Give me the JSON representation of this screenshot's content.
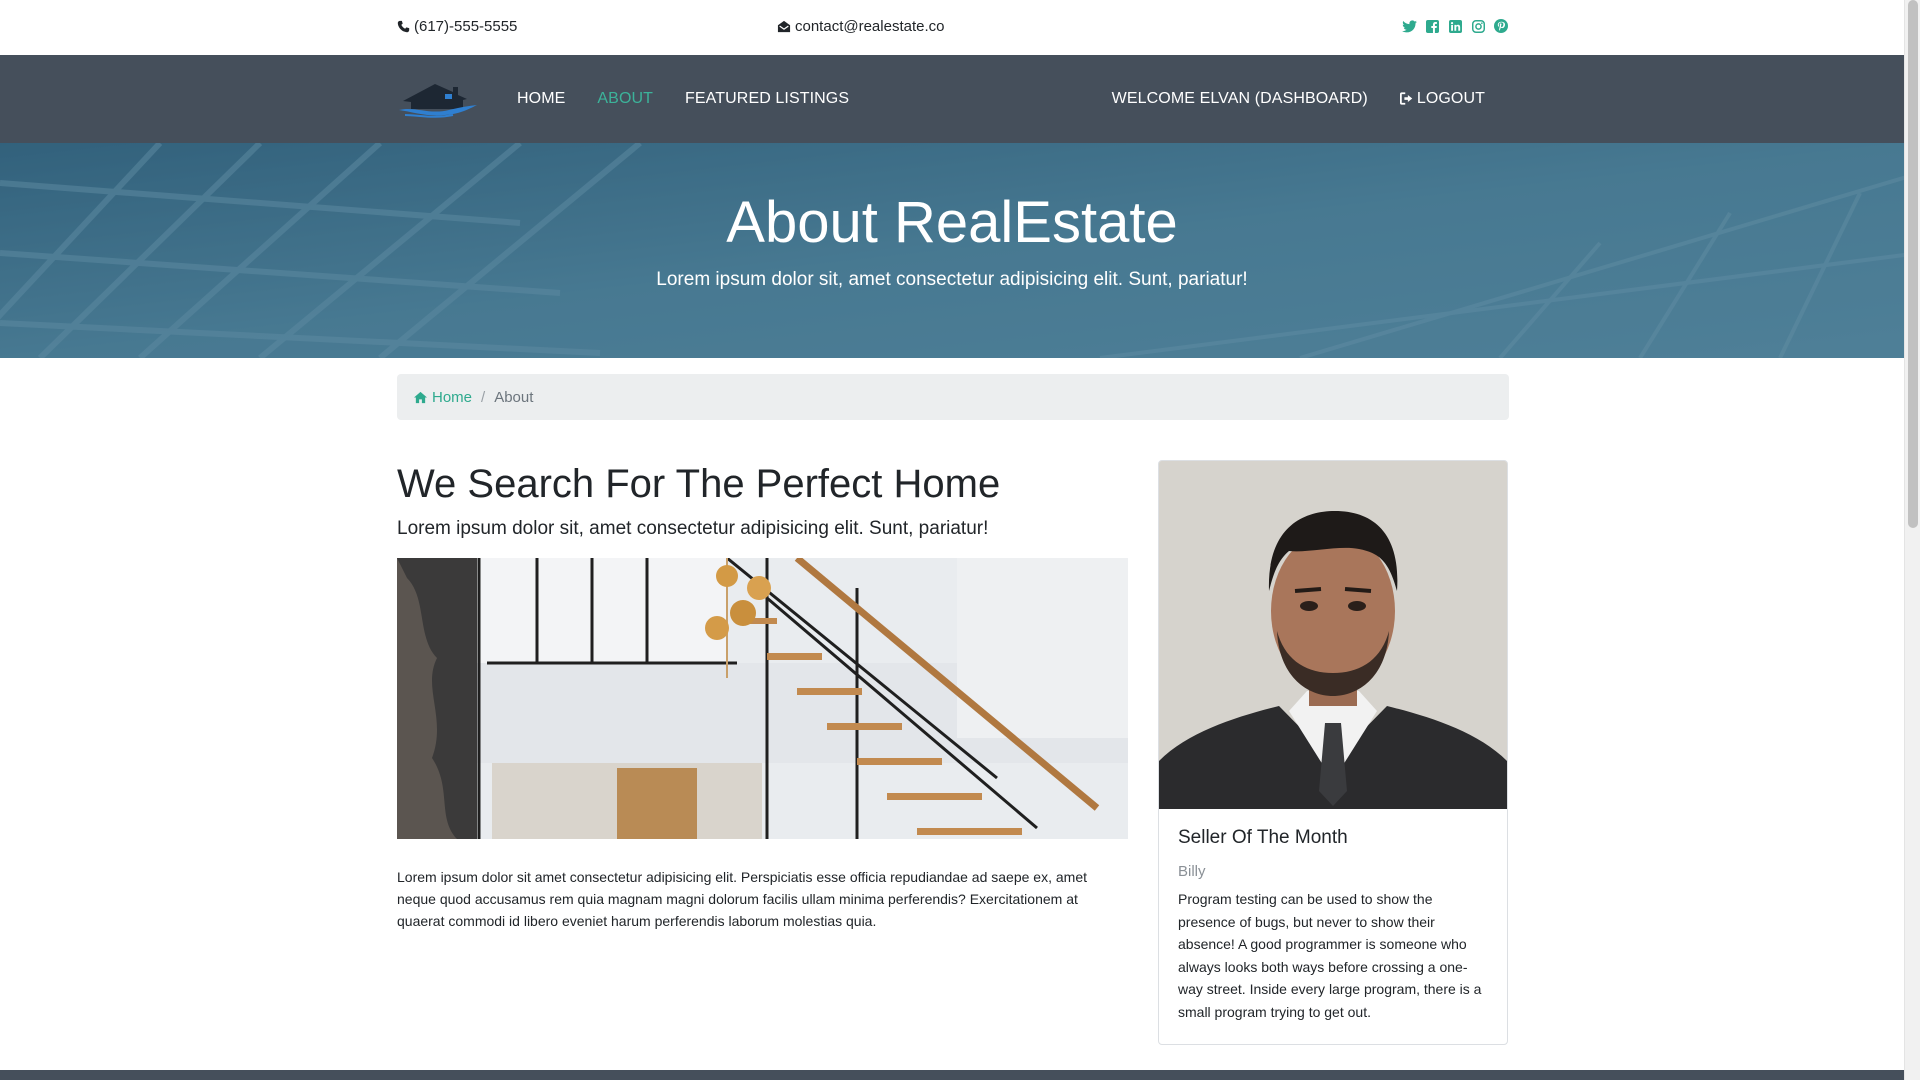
{
  "topbar": {
    "phone": "(617)-555-5555",
    "email": "contact@realestate.co",
    "social_icons": [
      "twitter-icon",
      "facebook-icon",
      "linkedin-icon",
      "instagram-icon",
      "pinterest-icon"
    ],
    "icon_color": "#2eaa8e"
  },
  "navbar": {
    "background": "#454f5b",
    "links": [
      {
        "label": "HOME"
      },
      {
        "label": "ABOUT",
        "active": true
      },
      {
        "label": "FEATURED LISTINGS"
      }
    ],
    "welcome": "WELCOME ELVAN (DASHBOARD)",
    "logout": "LOGOUT",
    "active_color": "#3cb39a"
  },
  "showcase": {
    "title": "About RealEstate",
    "subtitle": "Lorem ipsum dolor sit, amet consectetur adipisicing elit. Sunt, pariatur!"
  },
  "breadcrumb": {
    "home": "Home",
    "current": "About"
  },
  "main": {
    "heading": "We Search For The Perfect Home",
    "lead": "Lorem ipsum dolor sit, amet consectetur adipisicing elit. Sunt, pariatur!",
    "body": "Lorem ipsum dolor sit amet consectetur adipisicing elit. Perspiciatis esse officia repudiandae ad saepe ex, amet neque quod accusamus rem quia magnam magni dolorum facilis ullam minima perferendis? Exercitationem at quaerat commodi id libero eveniet harum perferendis laborum molestias quia."
  },
  "card": {
    "title": "Seller Of The Month",
    "name": "Billy",
    "bio": "Program testing can be used to show the presence of bugs, but never to show their absence! A good programmer is someone who always looks both ways before crossing a one-way street. Inside every large program, there is a small program trying to get out."
  }
}
